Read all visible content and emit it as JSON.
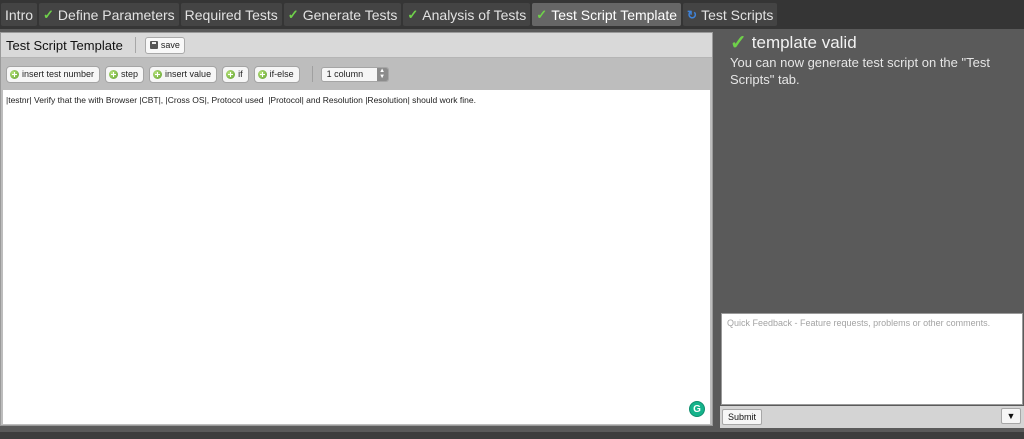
{
  "tabs": [
    {
      "label": "Intro",
      "icon": "",
      "active": false
    },
    {
      "label": "Define Parameters",
      "icon": "check-icon",
      "active": false
    },
    {
      "label": "Required Tests",
      "icon": "",
      "active": false
    },
    {
      "label": "Generate Tests",
      "icon": "check-icon",
      "active": false
    },
    {
      "label": "Analysis of Tests",
      "icon": "check-icon",
      "active": false
    },
    {
      "label": "Test Script Template",
      "icon": "check-icon",
      "active": true
    },
    {
      "label": "Test Scripts",
      "icon": "spinner-icon",
      "active": false
    }
  ],
  "tab_glyphs": {
    "check": "✓",
    "spinner": "↻"
  },
  "editor": {
    "title": "Test Script Template",
    "save_label": "save",
    "toolbar": {
      "buttons": [
        "insert test number",
        "step",
        "insert value",
        "if",
        "if-else"
      ],
      "columns_select": "1 column"
    },
    "template_text": "|testnr| Verify that the with Browser |CBT|, |Cross OS|, Protocol used  |Protocol| and Resolution |Resolution| should work fine.",
    "grammarly_glyph": "G"
  },
  "status": {
    "check_glyph": "✓",
    "title": "template valid",
    "message": "You can now generate test script on the \"Test Scripts\" tab."
  },
  "feedback": {
    "placeholder": "Quick Feedback - Feature requests, problems or other comments.",
    "submit_label": "Submit",
    "collapse_glyph": "▼"
  },
  "colors": {
    "accent_check": "#6fd14a",
    "spinner": "#3f83d9",
    "active_tab": "#666666",
    "tabbar": "#353535",
    "panel": "#5a5a5a"
  }
}
